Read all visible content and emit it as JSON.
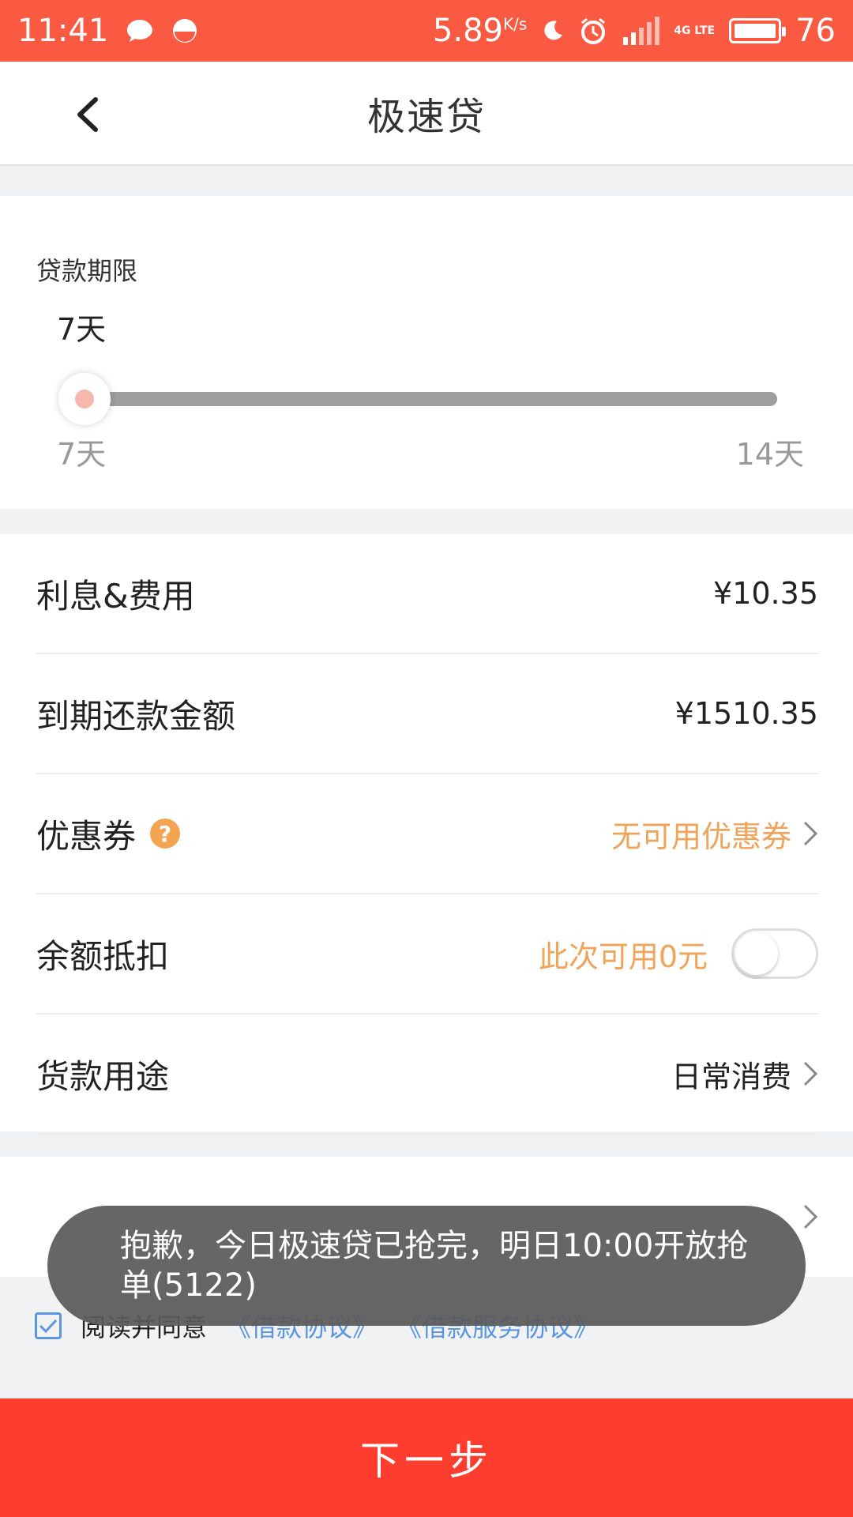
{
  "status_bar": {
    "time": "11:41",
    "net_speed": "5.89",
    "net_unit": "K/s",
    "network_type": "4G LTE",
    "battery": "76",
    "battery_level": 0.76
  },
  "header": {
    "title": "极速贷"
  },
  "loan_period": {
    "label": "贷款期限",
    "value": "7天",
    "min_label": "7天",
    "max_label": "14天",
    "slider_position": 0
  },
  "details": {
    "interest_label": "利息&费用",
    "interest_value": "¥10.35",
    "repay_label": "到期还款金额",
    "repay_value": "¥1510.35",
    "coupon_label": "优惠券",
    "coupon_help": "?",
    "coupon_value": "无可用优惠券",
    "balance_label": "余额抵扣",
    "balance_value": "此次可用0元",
    "balance_toggle": false,
    "purpose_label": "货款用途",
    "purpose_value": "日常消费"
  },
  "toast": {
    "message": "抱歉，今日极速贷已抢完，明日10:00开放抢单(5122)"
  },
  "agreement": {
    "checked": true,
    "prefix": "阅读并同意",
    "link1": "《借款协议》",
    "link2": "《借款服务协议》"
  },
  "footer": {
    "next_label": "下一步"
  },
  "colors": {
    "status_bar": "#fa5a41",
    "accent_orange": "#f0a45a",
    "button_red": "#ff3d2e",
    "link_blue": "#5b95e0"
  }
}
